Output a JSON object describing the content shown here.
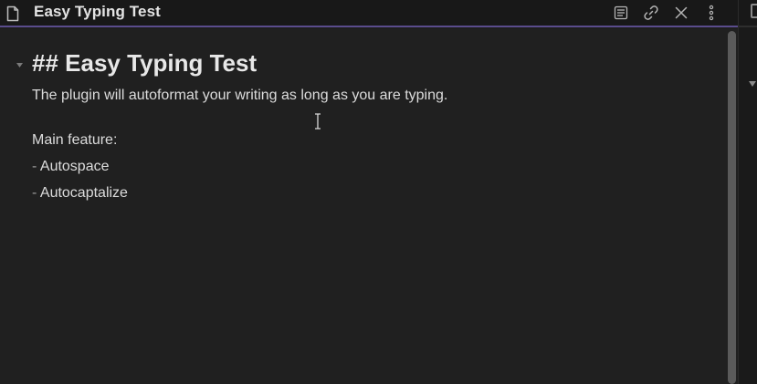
{
  "header": {
    "title": "Easy Typing Test",
    "file_icon": "file-icon",
    "actions": [
      {
        "name": "reading-view-icon"
      },
      {
        "name": "link-icon"
      },
      {
        "name": "close-icon"
      },
      {
        "name": "more-options-icon"
      }
    ]
  },
  "document": {
    "heading": "## Easy Typing Test",
    "paragraph": "The plugin will autoformat your writing as long as you are typing.",
    "feature_title": "Main feature:",
    "items": [
      {
        "marker": "-",
        "text": "Autospace"
      },
      {
        "marker": "-",
        "text": "Autocaptalize"
      }
    ]
  },
  "colors": {
    "accent": "#5a4c8c",
    "background": "#202020"
  }
}
